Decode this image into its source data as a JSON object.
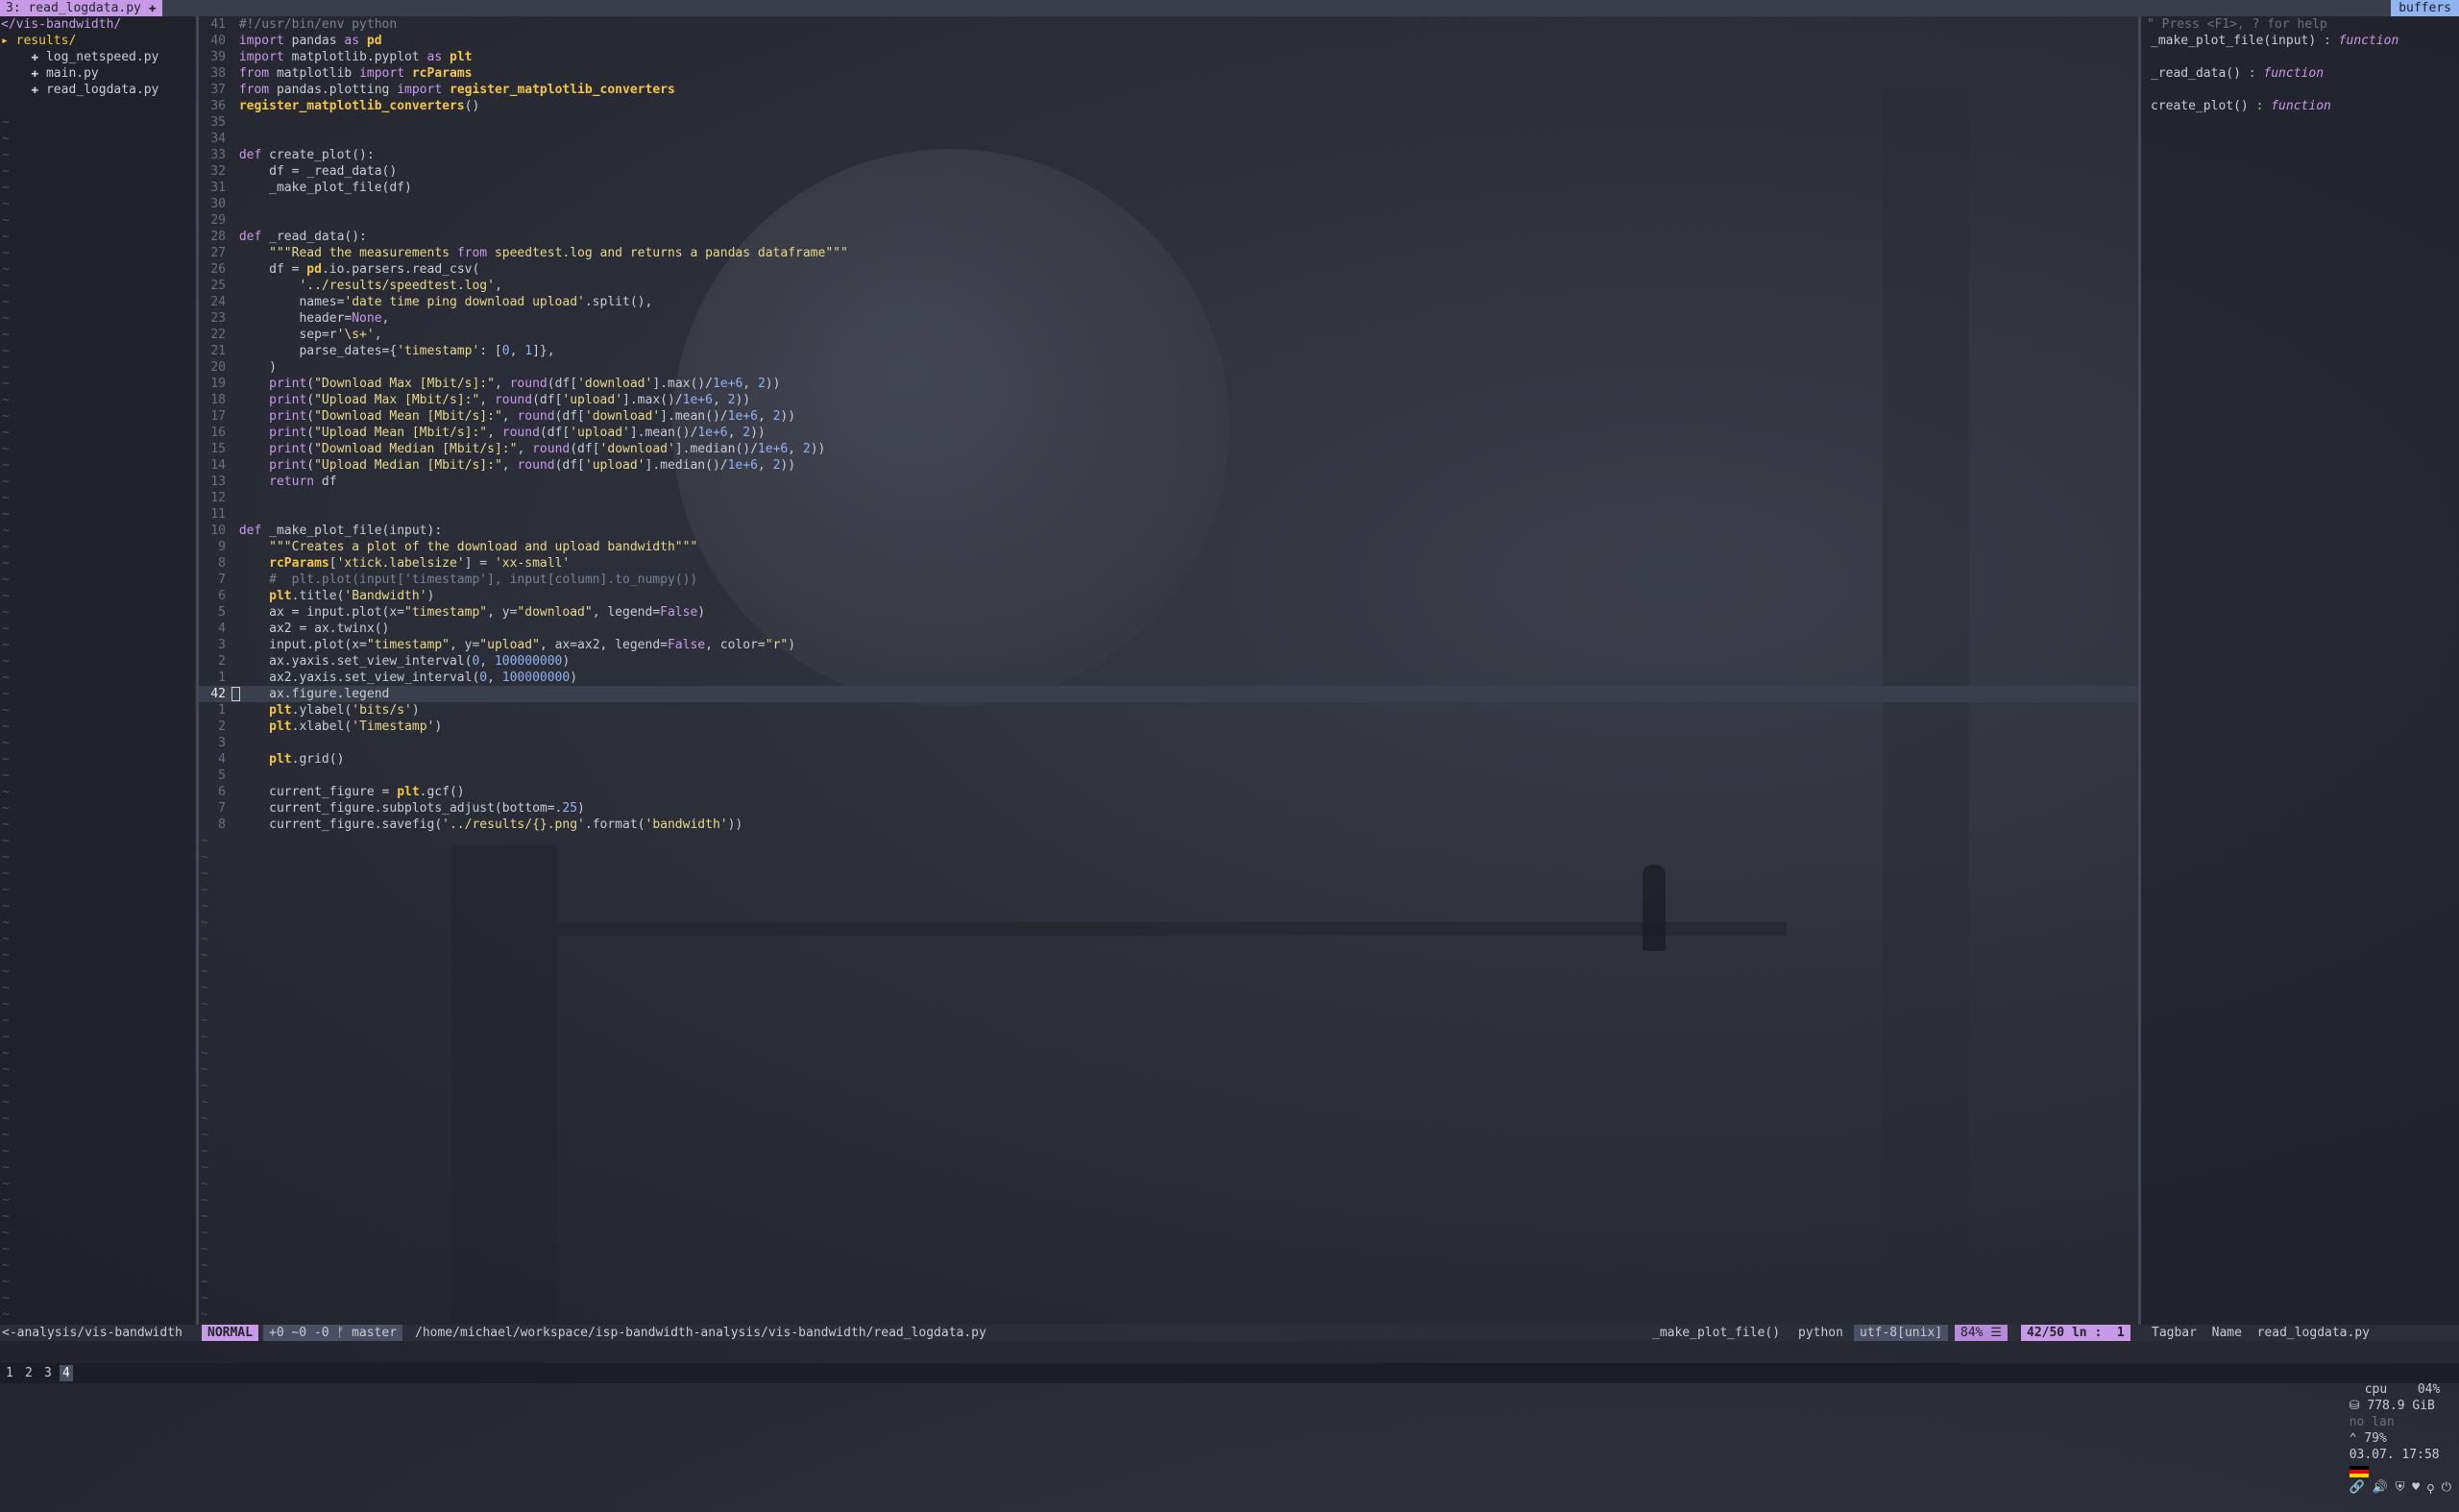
{
  "tabline": {
    "active_tab": "3: read_logdata.py",
    "modified_marker": "✚",
    "right_label": "buffers"
  },
  "tree": {
    "root": "</vis-bandwidth/",
    "items": [
      {
        "icon": "▸",
        "label": "results/",
        "kind": "dir"
      },
      {
        "icon": "✚",
        "label": "log_netspeed.py",
        "kind": "file"
      },
      {
        "icon": "✚",
        "label": "main.py",
        "kind": "file"
      },
      {
        "icon": "✚",
        "label": "read_logdata.py",
        "kind": "file"
      }
    ]
  },
  "editor": {
    "current_line": "42",
    "lines": [
      {
        "n": "41",
        "t": "#!/usr/bin/env python"
      },
      {
        "n": "40",
        "t": "import pandas as pd"
      },
      {
        "n": "39",
        "t": "import matplotlib.pyplot as plt"
      },
      {
        "n": "38",
        "t": "from matplotlib import rcParams"
      },
      {
        "n": "37",
        "t": "from pandas.plotting import register_matplotlib_converters"
      },
      {
        "n": "36",
        "t": "register_matplotlib_converters()"
      },
      {
        "n": "35",
        "t": ""
      },
      {
        "n": "34",
        "t": ""
      },
      {
        "n": "33",
        "t": "def create_plot():"
      },
      {
        "n": "32",
        "t": "    df = _read_data()"
      },
      {
        "n": "31",
        "t": "    _make_plot_file(df)"
      },
      {
        "n": "30",
        "t": ""
      },
      {
        "n": "29",
        "t": ""
      },
      {
        "n": "28",
        "t": "def _read_data():"
      },
      {
        "n": "27",
        "t": "    \"\"\"Read the measurements from speedtest.log and returns a pandas dataframe\"\"\""
      },
      {
        "n": "26",
        "t": "    df = pd.io.parsers.read_csv("
      },
      {
        "n": "25",
        "t": "        '../results/speedtest.log',"
      },
      {
        "n": "24",
        "t": "        names='date time ping download upload'.split(),"
      },
      {
        "n": "23",
        "t": "        header=None,"
      },
      {
        "n": "22",
        "t": "        sep=r'\\s+',"
      },
      {
        "n": "21",
        "t": "        parse_dates={'timestamp': [0, 1]},"
      },
      {
        "n": "20",
        "t": "    )"
      },
      {
        "n": "19",
        "t": "    print(\"Download Max [Mbit/s]:\", round(df['download'].max()/1e+6, 2))"
      },
      {
        "n": "18",
        "t": "    print(\"Upload Max [Mbit/s]:\", round(df['upload'].max()/1e+6, 2))"
      },
      {
        "n": "17",
        "t": "    print(\"Download Mean [Mbit/s]:\", round(df['download'].mean()/1e+6, 2))"
      },
      {
        "n": "16",
        "t": "    print(\"Upload Mean [Mbit/s]:\", round(df['upload'].mean()/1e+6, 2))"
      },
      {
        "n": "15",
        "t": "    print(\"Download Median [Mbit/s]:\", round(df['download'].median()/1e+6, 2))"
      },
      {
        "n": "14",
        "t": "    print(\"Upload Median [Mbit/s]:\", round(df['upload'].median()/1e+6, 2))"
      },
      {
        "n": "13",
        "t": "    return df"
      },
      {
        "n": "12",
        "t": ""
      },
      {
        "n": "11",
        "t": ""
      },
      {
        "n": "10",
        "t": "def _make_plot_file(input):"
      },
      {
        "n": "9",
        "t": "    \"\"\"Creates a plot of the download and upload bandwidth\"\"\""
      },
      {
        "n": "8",
        "t": "    rcParams['xtick.labelsize'] = 'xx-small'"
      },
      {
        "n": "7",
        "t": "    #  plt.plot(input['timestamp'], input[column].to_numpy())"
      },
      {
        "n": "6",
        "t": "    plt.title('Bandwidth')"
      },
      {
        "n": "5",
        "t": "    ax = input.plot(x=\"timestamp\", y=\"download\", legend=False)"
      },
      {
        "n": "4",
        "t": "    ax2 = ax.twinx()"
      },
      {
        "n": "3",
        "t": "    input.plot(x=\"timestamp\", y=\"upload\", ax=ax2, legend=False, color=\"r\")"
      },
      {
        "n": "2",
        "t": "    ax.yaxis.set_view_interval(0, 100000000)"
      },
      {
        "n": "1",
        "t": "    ax2.yaxis.set_view_interval(0, 100000000)"
      },
      {
        "n": "42",
        "t": "    ax.figure.legend"
      },
      {
        "n": "1",
        "t": "    plt.ylabel('bits/s')"
      },
      {
        "n": "2",
        "t": "    plt.xlabel('Timestamp')"
      },
      {
        "n": "3",
        "t": ""
      },
      {
        "n": "4",
        "t": "    plt.grid()"
      },
      {
        "n": "5",
        "t": ""
      },
      {
        "n": "6",
        "t": "    current_figure = plt.gcf()"
      },
      {
        "n": "7",
        "t": "    current_figure.subplots_adjust(bottom=.25)"
      },
      {
        "n": "8",
        "t": "    current_figure.savefig('../results/{}.png'.format('bandwidth'))"
      }
    ]
  },
  "tagbar": {
    "help": "\" Press <F1>, ? for help",
    "tags": [
      {
        "name": "_make_plot_file(input)",
        "kind": "function"
      },
      {
        "name": "_read_data()",
        "kind": "function"
      },
      {
        "name": "create_plot()",
        "kind": "function"
      }
    ]
  },
  "statusline": {
    "left": "<-analysis/vis-bandwidth",
    "mode": "NORMAL",
    "git": "+0 ~0 -0 ᚠ master",
    "path": "/home/michael/workspace/isp-bandwidth-analysis/vis-bandwidth/read_logdata.py",
    "function": "_make_plot_file()",
    "filetype": "python",
    "encoding": "utf-8[unix]",
    "percent": "84% ☰",
    "position": "42/50 ln :  1",
    "tagbar_label": "Tagbar",
    "tagbar_sort": "Name",
    "tagbar_file": "read_logdata.py"
  },
  "bottombar": {
    "workspaces": [
      "1",
      "2",
      "3",
      "4"
    ],
    "active_workspace": "4",
    "cpu_label": "cpu",
    "cpu": "04%",
    "disk": "⛁ 778.9 GiB",
    "lan": "no lan",
    "wifi": "⌃ 79%",
    "datetime": "03.07. 17:58"
  }
}
